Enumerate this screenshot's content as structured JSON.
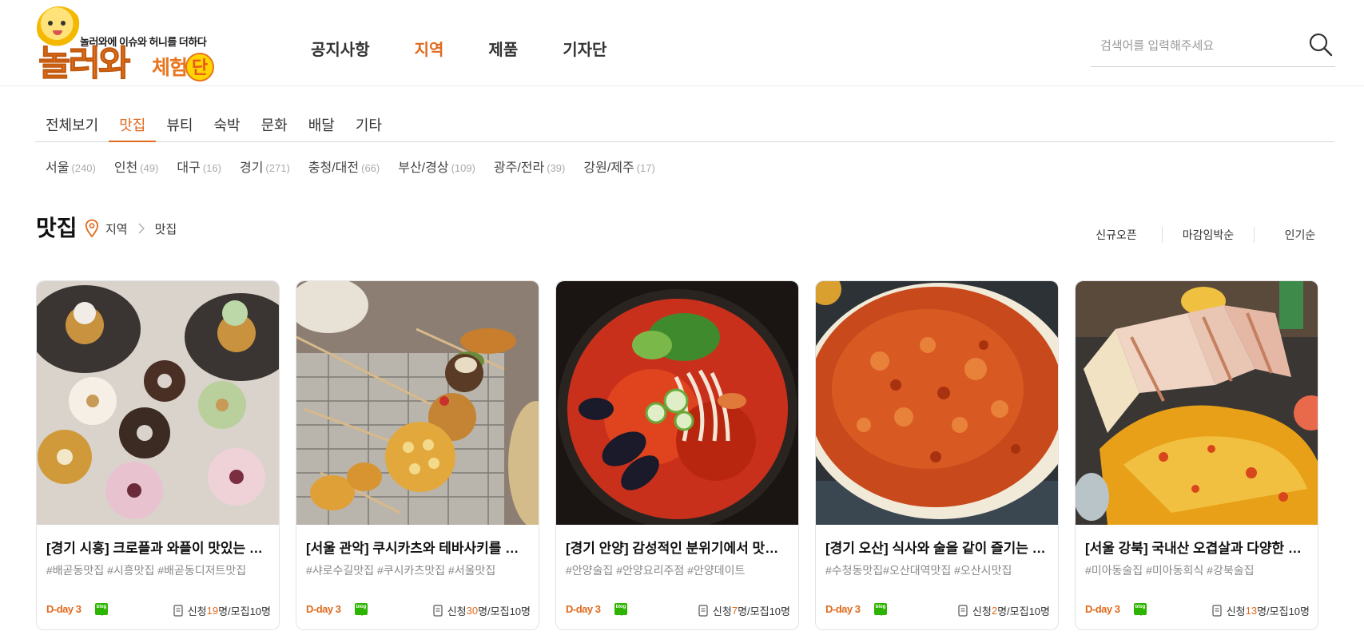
{
  "logo": {
    "tagline": "놀러와에 이슈와 허니를 더하다",
    "brand_main": "놀러와",
    "brand_sub": "체험",
    "brand_badge": "단"
  },
  "gnb": {
    "items": [
      {
        "label": "공지사항",
        "active": false
      },
      {
        "label": "지역",
        "active": true
      },
      {
        "label": "제품",
        "active": false
      },
      {
        "label": "기자단",
        "active": false
      }
    ]
  },
  "search": {
    "placeholder": "검색어를 입력해주세요",
    "icon": "search-icon"
  },
  "category_tabs": [
    {
      "label": "전체보기",
      "active": false
    },
    {
      "label": "맛집",
      "active": true
    },
    {
      "label": "뷰티",
      "active": false
    },
    {
      "label": "숙박",
      "active": false
    },
    {
      "label": "문화",
      "active": false
    },
    {
      "label": "배달",
      "active": false
    },
    {
      "label": "기타",
      "active": false
    }
  ],
  "regions": [
    {
      "name": "서울",
      "count": "(240)"
    },
    {
      "name": "인천",
      "count": "(49)"
    },
    {
      "name": "대구",
      "count": "(16)"
    },
    {
      "name": "경기",
      "count": "(271)"
    },
    {
      "name": "충청/대전",
      "count": "(66)"
    },
    {
      "name": "부산/경상",
      "count": "(109)"
    },
    {
      "name": "광주/전라",
      "count": "(39)"
    },
    {
      "name": "강원/제주",
      "count": "(17)"
    }
  ],
  "section": {
    "title": "맛집",
    "breadcrumb": [
      "지역",
      "맛집"
    ]
  },
  "sorts": [
    "신규오픈",
    "마감임박순",
    "인기순"
  ],
  "cards": [
    {
      "title": "[경기 시흥] 크로플과 와플이 맛있는 분위...",
      "tags": "#배곧동맛집 #시흥맛집 #배곧동디저트맛집",
      "dday": "D-day 3",
      "blog": "blog",
      "apply_prefix": "신청",
      "apply_num": "19",
      "apply_suffix": "명/모집10명",
      "image": "donuts"
    },
    {
      "title": "[서울 관악] 쿠시카츠와 테바사키를 주력...",
      "tags": "#샤로수길맛집 #쿠시카츠맛집 #서울맛집",
      "dday": "D-day 3",
      "blog": "blog",
      "apply_prefix": "신청",
      "apply_num": "30",
      "apply_suffix": "명/모집10명",
      "image": "kushikatsu"
    },
    {
      "title": "[경기 안양] 감성적인 분위기에서 맛있는 ...",
      "tags": "#안양술집 #안양요리주점 #안양데이트",
      "dday": "D-day 3",
      "blog": "blog",
      "apply_prefix": "신청",
      "apply_num": "7",
      "apply_suffix": "명/모집10명",
      "image": "jjamppong"
    },
    {
      "title": "[경기 오산] 식사와 술을 같이 즐기는 안...",
      "tags": "#수청동맛집#오산대역맛집 #오산시맛집",
      "dday": "D-day 3",
      "blog": "blog",
      "apply_prefix": "신청",
      "apply_num": "2",
      "apply_suffix": "명/모집10명",
      "image": "kimchi-pancake"
    },
    {
      "title": "[서울 강북] 국내산 오겹살과 다양한 맛있...",
      "tags": "#미아동술집 #미아동회식 #강북술집",
      "dday": "D-day 3",
      "blog": "blog",
      "apply_prefix": "신청",
      "apply_num": "13",
      "apply_suffix": "명/모집10명",
      "image": "pork-belly"
    }
  ],
  "colors": {
    "accent": "#e06a1e",
    "blog_green": "#2db400"
  }
}
